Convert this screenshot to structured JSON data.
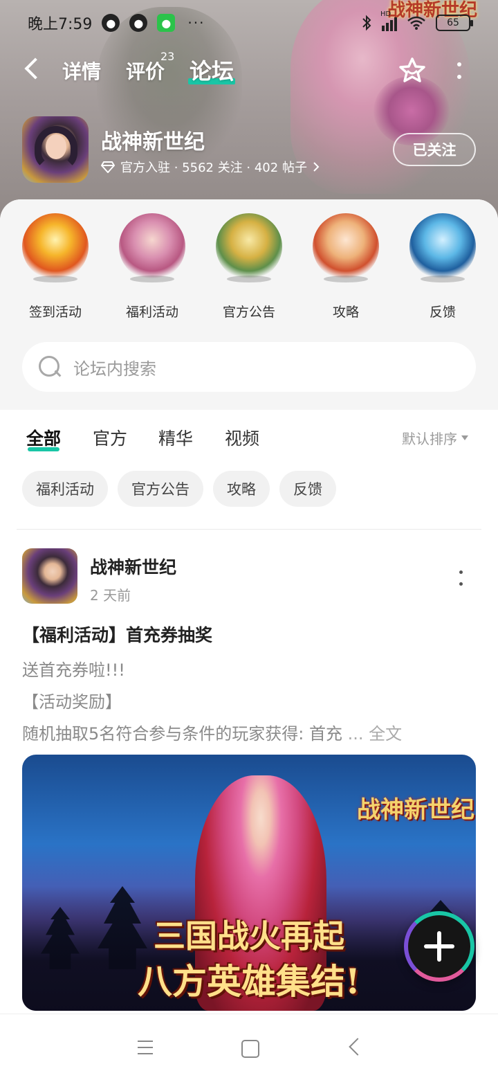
{
  "status_bar": {
    "time": "晚上7:59",
    "more": "···",
    "hd": "HD",
    "battery": "65",
    "apps": [
      "qq-icon",
      "qq-icon",
      "wechat-icon"
    ]
  },
  "header": {
    "tabs": [
      {
        "label": "详情"
      },
      {
        "label": "评价",
        "badge": "23"
      },
      {
        "label": "论坛",
        "active": true
      }
    ],
    "background_logo": "战神新世纪",
    "accent_color": "#19c6a6"
  },
  "game": {
    "name": "战神新世纪",
    "meta": "官方入驻 · 5562 关注 · 402 帖子",
    "follow_label": "已关注"
  },
  "quick_links": [
    {
      "label": "签到活动",
      "icon": "sign-in-art"
    },
    {
      "label": "福利活动",
      "icon": "welfare-art"
    },
    {
      "label": "官方公告",
      "icon": "announcement-art"
    },
    {
      "label": "攻略",
      "icon": "guide-art"
    },
    {
      "label": "反馈",
      "icon": "feedback-art"
    }
  ],
  "search": {
    "placeholder": "论坛内搜索"
  },
  "filter_tabs": [
    {
      "label": "全部",
      "active": true
    },
    {
      "label": "官方"
    },
    {
      "label": "精华"
    },
    {
      "label": "视频"
    }
  ],
  "sort_label": "默认排序",
  "chips": [
    "福利活动",
    "官方公告",
    "攻略",
    "反馈"
  ],
  "post": {
    "author": "战神新世纪",
    "time": "2 天前",
    "title": "【福利活动】首充券抽奖",
    "lines": [
      "送首充券啦!!!",
      "【活动奖励】",
      "随机抽取5名符合参与条件的玩家获得: 首充"
    ],
    "ellipsis": "...",
    "read_more": "全文",
    "image": {
      "logo": "战神新世纪",
      "slogan_line1": "三国战火再起",
      "slogan_line2": "八方英雄集结!"
    }
  }
}
